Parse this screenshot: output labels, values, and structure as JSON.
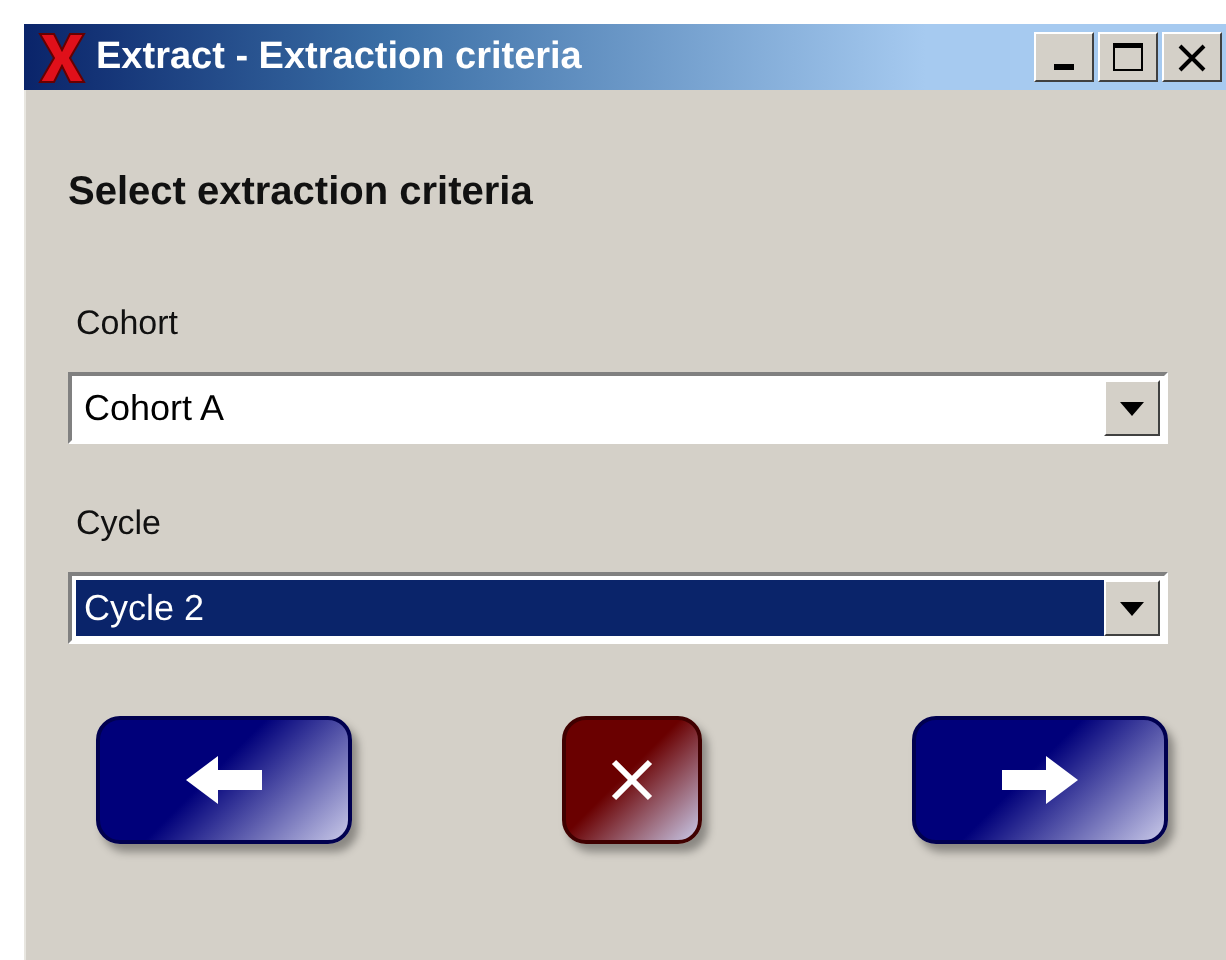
{
  "window": {
    "title": "Extract - Extraction criteria"
  },
  "heading": "Select extraction criteria",
  "fields": [
    {
      "label": "Cohort",
      "value": "Cohort A",
      "selected": false
    },
    {
      "label": "Cycle",
      "value": "Cycle 2",
      "selected": true
    }
  ],
  "buttons": [
    {
      "kind": "back"
    },
    {
      "kind": "cancel"
    },
    {
      "kind": "next"
    }
  ]
}
